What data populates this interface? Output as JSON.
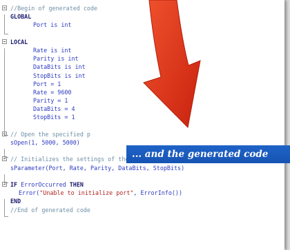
{
  "code_lines": {
    "l1": "//Begin of generated code",
    "l2": "GLOBAL",
    "l3": "Port is int",
    "l5": "LOCAL",
    "l6": "Rate is int",
    "l7": "Parity is int",
    "l8": "DataBits is int",
    "l9": "StopBits is int",
    "l10": "Port = 1",
    "l11": "Rate = 9600",
    "l12": "Parity = 1",
    "l13": "DataBits = 4",
    "l14": "StopBits = 1",
    "l16": "// Open the specified p",
    "l17": "sOpen(1, 5000, 5000)",
    "l19": "// Initializes the settings of the serial port",
    "l20": "sParameter(Port, Rate, Parity, DataBits, StopBits)",
    "l22_kw1": "IF",
    "l22_var": "ErrorOccurred",
    "l22_kw2": "THEN",
    "l23_fn": "Error(",
    "l23_str": "\"Unable to initialize port\"",
    "l23_rest": ", ErrorInfo())",
    "l24": "END",
    "l25": "//End of generated code"
  },
  "banner": {
    "text": "... and the generated code"
  },
  "colors": {
    "banner_bg": "#1b5cc0",
    "arrow": "#e8391f",
    "code_text": "#2b3a8a",
    "comment": "#6d8fa6"
  }
}
